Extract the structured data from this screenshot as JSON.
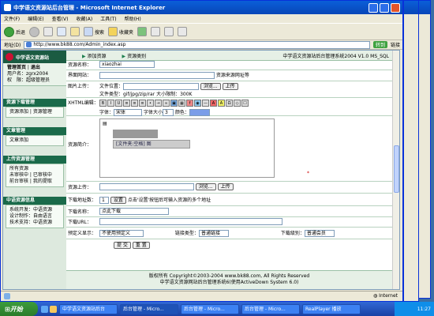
{
  "window": {
    "title": "中学语文资源站后台管理 - Microsoft Internet Explorer"
  },
  "menu": [
    "文件(F)",
    "编辑(E)",
    "查看(V)",
    "收藏(A)",
    "工具(T)",
    "帮助(H)"
  ],
  "toolbar": {
    "back": "后退",
    "search": "搜索",
    "favorites": "收藏夹"
  },
  "address": {
    "label": "地址(D)",
    "url": "http://www.bk88.com/Admin_index.asp",
    "go": "转到",
    "links": "链接"
  },
  "sidebar": {
    "logo": "中学语文资源站",
    "top_links": [
      "管理首页",
      "退出"
    ],
    "user_label": "用户名：",
    "user_value": "zgrx2004",
    "role_label": "权　限：",
    "role_value": "超级管理员",
    "sections": [
      {
        "title": "资源下载管理",
        "items": [
          "资源添加",
          "资源管理"
        ]
      },
      {
        "title": "文章管理",
        "items": [
          "文章添加"
        ]
      },
      {
        "title": "上传资源管理",
        "items": [
          "所有资源",
          "未审核中",
          "已审核中",
          "前台审核",
          "我的提取"
        ]
      },
      {
        "title": "中语资源信息",
        "items": [
          "系统开发：中语资源",
          "设计制作：自由语言",
          "技术支持：中语资源"
        ]
      }
    ]
  },
  "header": {
    "nav1": "添加资源",
    "nav2": "资源类别",
    "version": "中学语文资源站后台管理系统2004 V1.0 MS_SQL"
  },
  "form": {
    "src_label": "资源名称：",
    "src_value": "xiaozhai",
    "site_label": "界面网站：",
    "site_hint": "资源来源网址等",
    "img_label": "图片上传：",
    "img_file_label": "文件位置：",
    "browse": "浏览...",
    "upload": "上传",
    "img_types": "文件类型：gif/jpg/zip/rar 大小限制：300K",
    "desc_tool_label": "XHTML编辑：",
    "font_label": "字体：",
    "font_value": "宋体",
    "size_label": "字体大小",
    "size_value": "3",
    "color_label": "颜色：",
    "desc_label": "资源简介：",
    "editor_text": "[文件夹:空格] 图",
    "file_label": "资源上传：",
    "file_browse": "浏览...",
    "file_upload": "上传",
    "dl_count_label": "下载地址数：",
    "dl_count_value": "1",
    "dl_count_btn": "设置",
    "dl_count_hint": "点击'设置'按钮后可输入资源的多个地址",
    "dl_name_label": "下载名称：",
    "dl_name_value": "点此下载",
    "dl_url_label": "下载URL：",
    "preview_label": "预定义显示：",
    "preview_value": "不使用预定义",
    "type_label": "链接类型：",
    "type_value": "普通链接",
    "level_label": "下载级别：",
    "level_value": "普通会员",
    "submit": "提 交",
    "reset": "重 置"
  },
  "footer": {
    "line1": "版权所有 Copyright©2003-2004 www.bk88.com, All Rights Reserved",
    "line2": "中学语文资源网站后台管理系统6(使用ActiveDown System 6.0)"
  },
  "status": {
    "zone": "Internet"
  },
  "taskbar": {
    "start": "开始",
    "tasks": [
      "中学语文资源站后台",
      "后台管理 - Micro...",
      "后台管理 - Micro...",
      "后台管理 - Micro...",
      "RealPlayer 播放"
    ],
    "clock": "11:27"
  }
}
